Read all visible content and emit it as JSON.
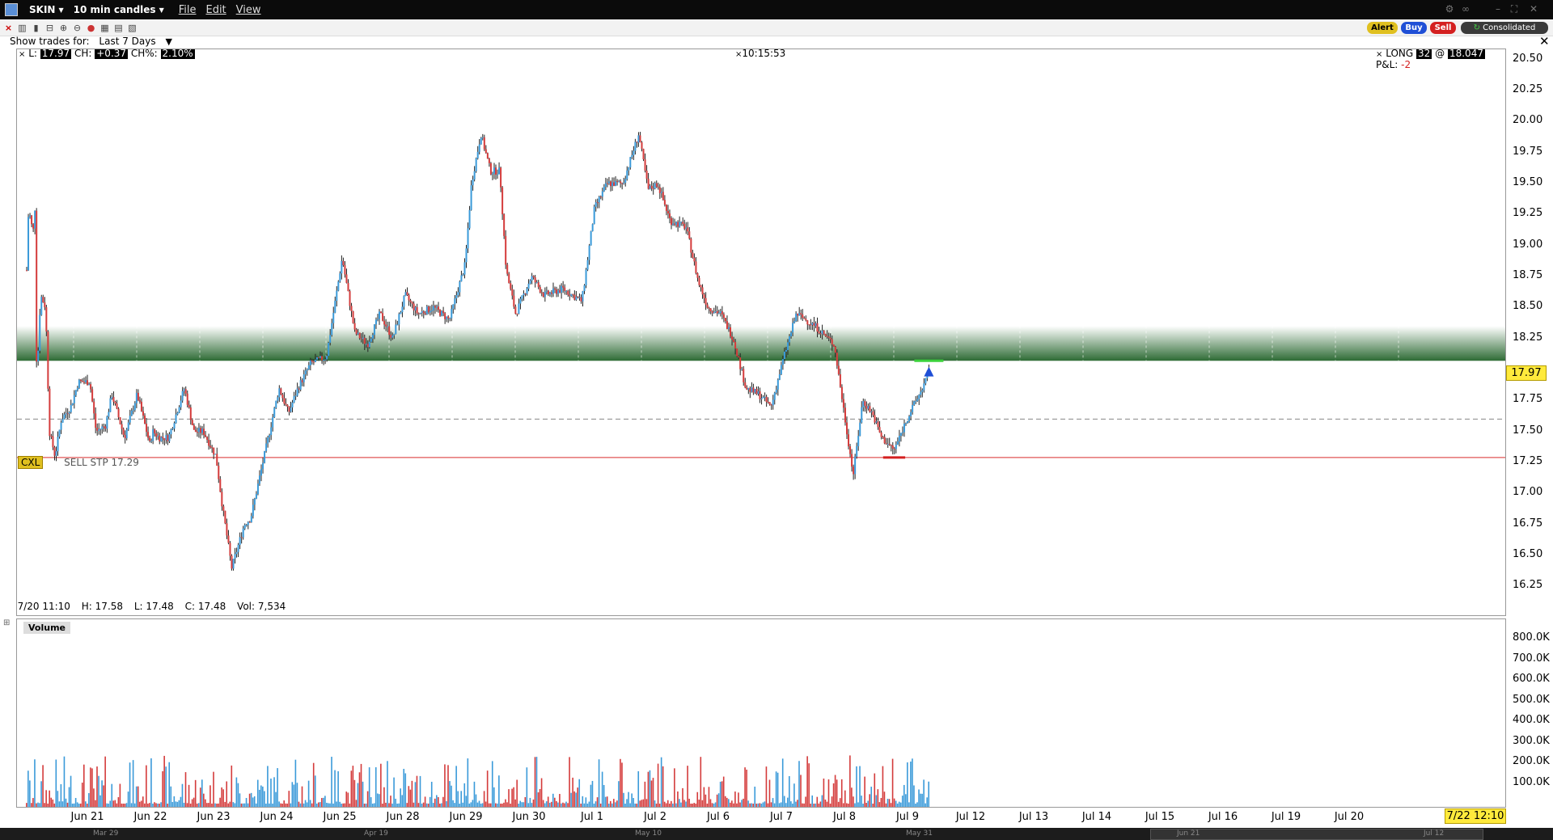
{
  "app": {
    "symbol": "SKIN",
    "interval": "10 min candles",
    "menus": [
      "File",
      "Edit",
      "View"
    ]
  },
  "toolbar": {
    "show_trades_label": "Show trades for:",
    "show_trades_value": "Last 7 Days",
    "alert_label": "Alert",
    "buy_label": "Buy",
    "sell_label": "Sell",
    "consolidated_label": "Consolidated"
  },
  "header": {
    "last_label": "L:",
    "last_value": "17.97",
    "change_label": "CH:",
    "change_value": "+0.37",
    "change_pct_label": "CH%:",
    "change_pct_value": "2.10%",
    "time": "10:15:53",
    "position_label": "LONG",
    "position_qty": "32",
    "position_at": "@",
    "position_avg": "18.047",
    "pnl_label": "P&L:",
    "pnl_value": "-2"
  },
  "order": {
    "cancel_label": "CXL",
    "order_text": "SELL STP 17.29"
  },
  "bar_info": {
    "date": "7/20 11:10",
    "high_label": "H:",
    "high": "17.58",
    "low_label": "L:",
    "low": "17.48",
    "close_label": "C:",
    "close": "17.48",
    "vol_label": "Vol:",
    "vol": "7,534"
  },
  "volume": {
    "panel_label": "Volume",
    "axis_labels": [
      "800.0K",
      "700.0K",
      "600.0K",
      "500.0K",
      "400.0K",
      "300.0K",
      "200.0K",
      "100.0K"
    ]
  },
  "last_price_tag": "17.97",
  "current_datetime": "7/22 12:10",
  "navigator_labels": [
    "Mar 29",
    "Apr 19",
    "May 10",
    "May 31",
    "Jun 21",
    "Jul 12"
  ],
  "colors": {
    "up": "#3a9ad9",
    "down": "#d43b3b",
    "stop_line": "#e05555",
    "band": "#2e6b35",
    "price_tag": "#ffea3c"
  },
  "chart_data": {
    "type": "candlestick",
    "y_ticks": [
      "20.50",
      "20.25",
      "20.00",
      "19.75",
      "19.50",
      "19.25",
      "19.00",
      "18.75",
      "18.50",
      "18.25",
      "17.75",
      "17.50",
      "17.25",
      "17.00",
      "16.75",
      "16.50",
      "16.25"
    ],
    "ylim": [
      16.05,
      20.55
    ],
    "x_ticks": [
      "Jun 21",
      "Jun 22",
      "Jun 23",
      "Jun 24",
      "Jun 25",
      "Jun 28",
      "Jun 29",
      "Jun 30",
      "Jul 1",
      "Jul 2",
      "Jul 6",
      "Jul 7",
      "Jul 8",
      "Jul 9",
      "Jul 12",
      "Jul 13",
      "Jul 14",
      "Jul 15",
      "Jul 16",
      "Jul 19",
      "Jul 20"
    ],
    "stop_price": 17.29,
    "avg_cost_price": 17.6,
    "band_low": 18.07,
    "band_high": 18.35,
    "last": 17.97,
    "path": [
      [
        0,
        18.8
      ],
      [
        0.03,
        19.3
      ],
      [
        0.1,
        19.1
      ],
      [
        0.13,
        19.3
      ],
      [
        0.16,
        17.9
      ],
      [
        0.22,
        18.6
      ],
      [
        0.3,
        18.5
      ],
      [
        0.36,
        17.5
      ],
      [
        0.45,
        17.3
      ],
      [
        0.55,
        17.6
      ],
      [
        0.7,
        17.7
      ],
      [
        0.82,
        17.9
      ],
      [
        1,
        17.9
      ],
      [
        1.1,
        17.5
      ],
      [
        1.25,
        17.55
      ],
      [
        1.35,
        17.8
      ],
      [
        1.55,
        17.45
      ],
      [
        1.75,
        17.8
      ],
      [
        1.95,
        17.4
      ],
      [
        2.0,
        17.5
      ],
      [
        2.1,
        17.45
      ],
      [
        2.25,
        17.45
      ],
      [
        2.5,
        17.85
      ],
      [
        2.65,
        17.5
      ],
      [
        2.8,
        17.5
      ],
      [
        3.0,
        17.3
      ],
      [
        3.1,
        16.9
      ],
      [
        3.25,
        16.4
      ],
      [
        3.45,
        16.75
      ],
      [
        3.55,
        16.8
      ],
      [
        4.0,
        17.85
      ],
      [
        4.15,
        17.65
      ],
      [
        4.3,
        17.85
      ],
      [
        4.5,
        18.05
      ],
      [
        4.75,
        18.1
      ],
      [
        5.0,
        18.9
      ],
      [
        5.2,
        18.3
      ],
      [
        5.4,
        18.2
      ],
      [
        5.6,
        18.45
      ],
      [
        5.8,
        18.25
      ],
      [
        6.0,
        18.6
      ],
      [
        6.2,
        18.45
      ],
      [
        6.45,
        18.5
      ],
      [
        6.7,
        18.4
      ],
      [
        6.95,
        18.85
      ],
      [
        7.05,
        19.5
      ],
      [
        7.2,
        19.9
      ],
      [
        7.35,
        19.6
      ],
      [
        7.5,
        19.6
      ],
      [
        7.6,
        18.8
      ],
      [
        7.75,
        18.45
      ],
      [
        8.0,
        18.75
      ],
      [
        8.2,
        18.6
      ],
      [
        8.5,
        18.65
      ],
      [
        8.8,
        18.55
      ],
      [
        9.0,
        19.3
      ],
      [
        9.2,
        19.5
      ],
      [
        9.45,
        19.5
      ],
      [
        9.7,
        19.9
      ],
      [
        9.85,
        19.45
      ],
      [
        10.0,
        19.5
      ],
      [
        10.2,
        19.2
      ],
      [
        10.45,
        19.15
      ],
      [
        10.65,
        18.7
      ],
      [
        10.8,
        18.5
      ],
      [
        11.0,
        18.45
      ],
      [
        11.2,
        18.25
      ],
      [
        11.4,
        17.85
      ],
      [
        11.6,
        17.8
      ],
      [
        11.8,
        17.7
      ],
      [
        12.0,
        18.1
      ],
      [
        12.2,
        18.45
      ],
      [
        12.5,
        18.35
      ],
      [
        12.8,
        18.2
      ],
      [
        13.0,
        17.5
      ],
      [
        13.1,
        17.15
      ],
      [
        13.25,
        17.75
      ],
      [
        13.4,
        17.65
      ],
      [
        13.55,
        17.45
      ],
      [
        13.75,
        17.35
      ],
      [
        13.95,
        17.6
      ],
      [
        14.15,
        17.8
      ],
      [
        14.3,
        17.97
      ]
    ]
  }
}
